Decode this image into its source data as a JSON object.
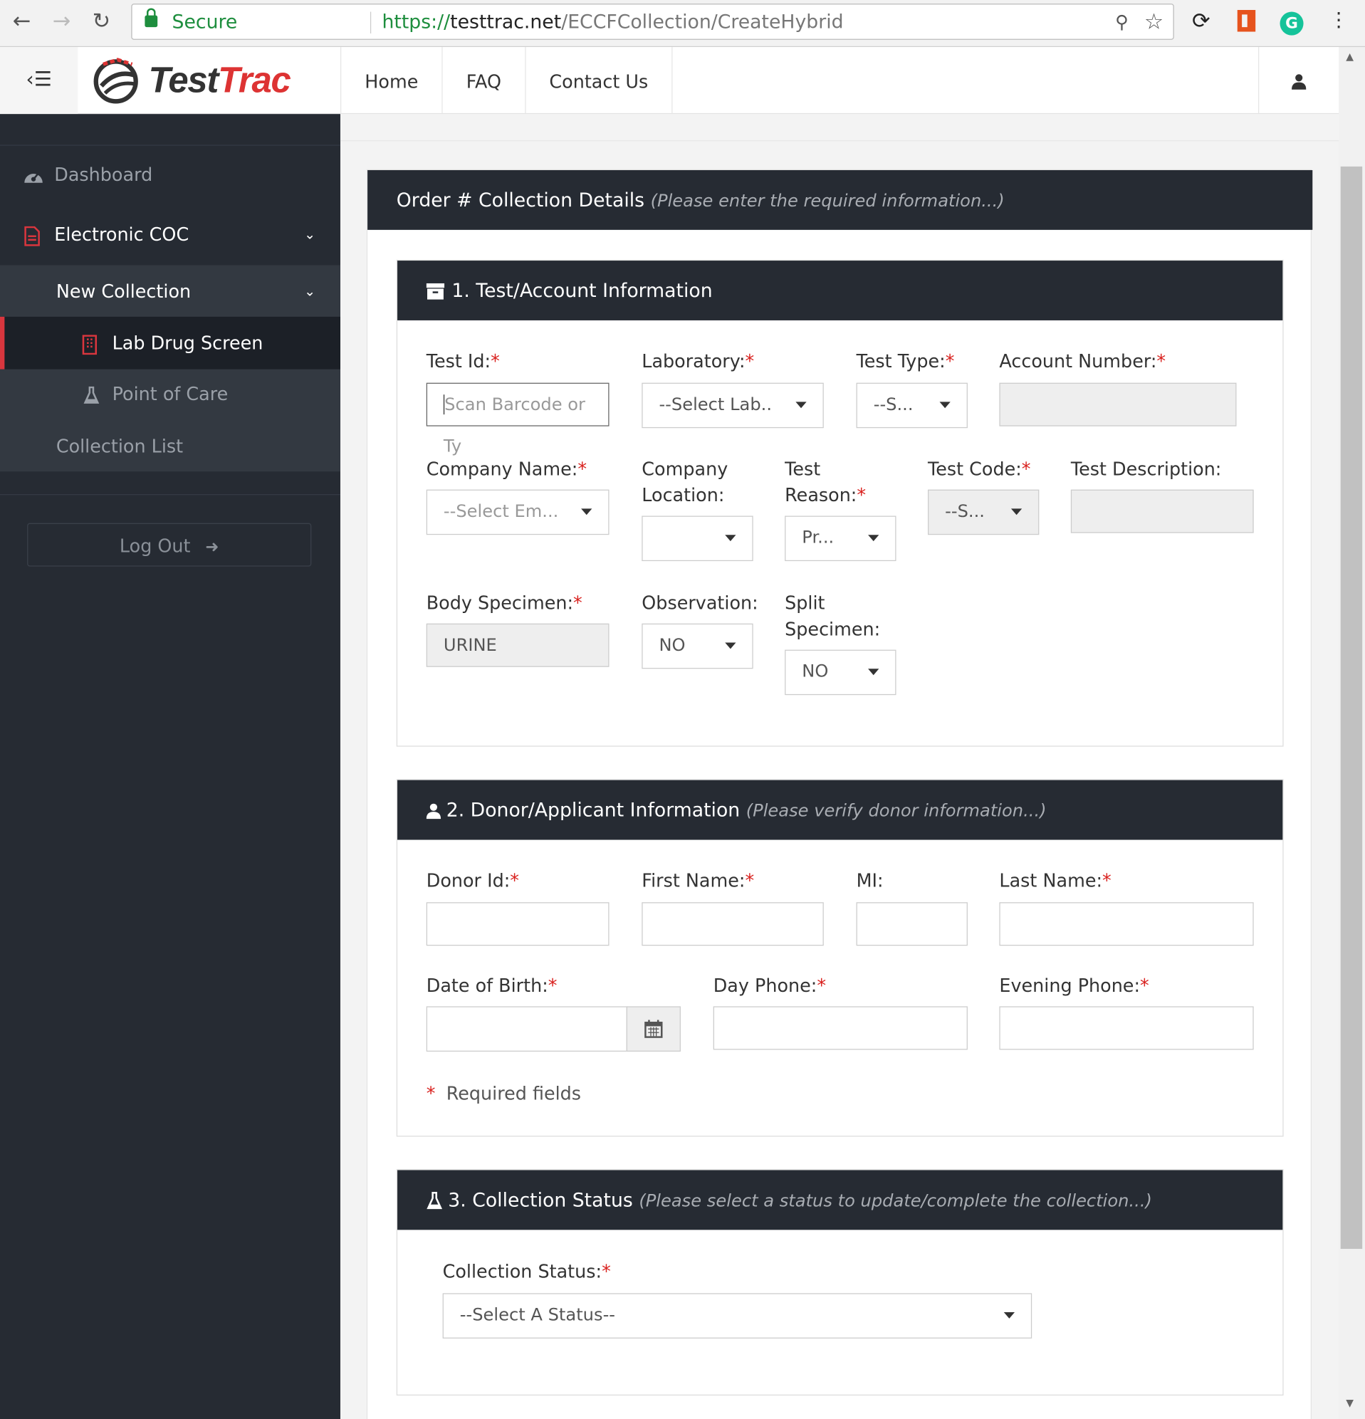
{
  "browser": {
    "secure_label": "Secure",
    "url_scheme": "https://",
    "url_host": "testtrac.net",
    "url_path": "/ECCFCollection/CreateHybrid"
  },
  "header": {
    "brand_a": "Test",
    "brand_b": "Trac",
    "nav": [
      "Home",
      "FAQ",
      "Contact Us"
    ]
  },
  "sidebar": {
    "dashboard": "Dashboard",
    "electronic_coc": "Electronic COC",
    "new_collection": "New Collection",
    "lab_drug_screen": "Lab Drug Screen",
    "point_of_care": "Point of Care",
    "collection_list": "Collection List",
    "logout": "Log Out"
  },
  "order": {
    "title": "Order # Collection Details",
    "subtitle": "(Please enter the required information...)"
  },
  "section1": {
    "title": "1. Test/Account Information",
    "test_id_label": "Test Id:",
    "test_id_placeholder": "Scan Barcode or Ty",
    "laboratory_label": "Laboratory:",
    "laboratory_value": "--Select Lab..",
    "test_type_label": "Test Type:",
    "test_type_value": "--S...",
    "account_number_label": "Account Number:",
    "company_name_label": "Company Name:",
    "company_name_value": "--Select Em...",
    "company_location_label_1": "Company",
    "company_location_label_2": "Location:",
    "test_reason_label_1": "Test",
    "test_reason_label_2": "Reason:",
    "test_reason_value": "Pr...",
    "test_code_label": "Test Code:",
    "test_code_value": "--S...",
    "test_description_label": "Test Description:",
    "body_specimen_label": "Body Specimen:",
    "body_specimen_value": "URINE",
    "observation_label": "Observation:",
    "observation_value": "NO",
    "split_specimen_label_1": "Split",
    "split_specimen_label_2": "Specimen:",
    "split_specimen_value": "NO"
  },
  "section2": {
    "title": "2. Donor/Applicant Information",
    "subtitle": "(Please verify donor information...)",
    "donor_id_label": "Donor Id:",
    "first_name_label": "First Name:",
    "mi_label": "MI:",
    "last_name_label": "Last Name:",
    "dob_label": "Date of Birth:",
    "day_phone_label": "Day Phone:",
    "evening_phone_label": "Evening Phone:",
    "required_note": "Required fields"
  },
  "section3": {
    "title": "3. Collection Status",
    "subtitle": "(Please select a status to update/complete the collection...)",
    "status_label": "Collection Status:",
    "status_value": "--Select A Status--"
  },
  "required_marker": "*"
}
